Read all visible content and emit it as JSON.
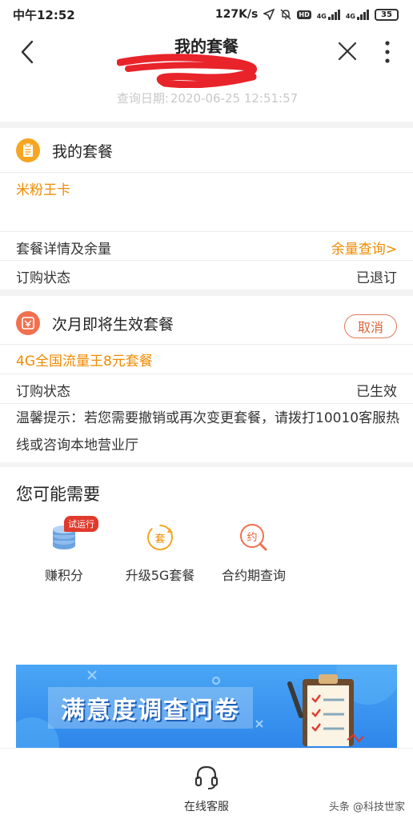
{
  "status_bar": {
    "time": "中午12:52",
    "speed": "127K/s",
    "network1": "4G",
    "network2": "4G",
    "hd": "HD",
    "battery": "35"
  },
  "header": {
    "title": "我的套餐",
    "query_label": "查询日期:",
    "query_date": "2020-06-25 12:51:57"
  },
  "current_plan": {
    "title": "我的套餐",
    "plan_name": "米粉王卡",
    "details_label": "套餐详情及余量",
    "details_link": "余量查询>",
    "status_label": "订购状态",
    "status_value": "已退订"
  },
  "next_plan": {
    "title": "次月即将生效套餐",
    "cancel_label": "取消",
    "plan_name": "4G全国流量王8元套餐",
    "status_label": "订购状态",
    "status_value": "已生效",
    "tip": "温馨提示：若您需要撤销或再次变更套餐，请拨打10010客服热线或咨询本地营业厅"
  },
  "may_need": {
    "title": "您可能需要",
    "badge": "试运行",
    "items": [
      {
        "label": "赚积分",
        "icon": "coins-icon"
      },
      {
        "label": "升级5G套餐",
        "icon": "upgrade-plan-icon",
        "glyph": "套"
      },
      {
        "label": "合约期查询",
        "icon": "contract-search-icon",
        "glyph": "约"
      }
    ]
  },
  "banner": {
    "text": "满意度调查问卷"
  },
  "bottom": {
    "service_label": "在线客服",
    "watermark": "头条 @科技世家"
  },
  "colors": {
    "accent_orange": "#f08a00",
    "cancel_red": "#d9643a",
    "banner_blue": "#2e86ea"
  }
}
